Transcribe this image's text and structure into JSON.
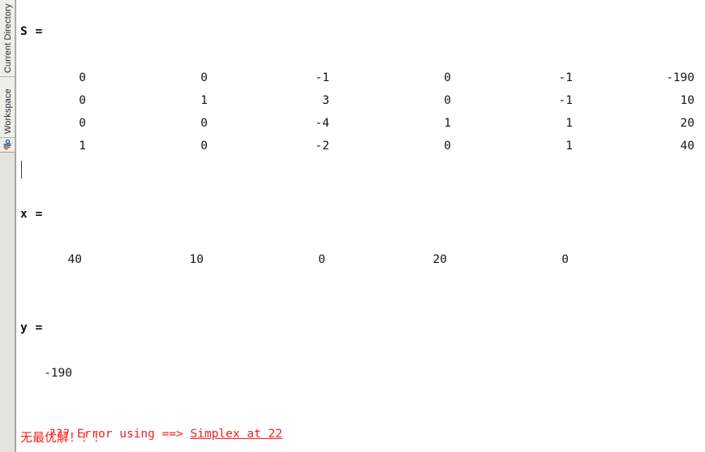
{
  "sidebar": {
    "tabs": [
      {
        "id": "current-directory",
        "label": "Current Directory"
      },
      {
        "id": "workspace",
        "label": "Workspace"
      }
    ],
    "logo_icon": "matlab-membrane-icon"
  },
  "command_window": {
    "blocks": [
      {
        "name": "S",
        "label": "S =",
        "kind": "matrix",
        "rows": [
          [
            "0",
            "0",
            "-1",
            "0",
            "-1",
            "-190"
          ],
          [
            "0",
            "1",
            "3",
            "0",
            "-1",
            "10"
          ],
          [
            "0",
            "0",
            "-4",
            "1",
            "1",
            "20"
          ],
          [
            "1",
            "0",
            "-2",
            "0",
            "1",
            "40"
          ]
        ]
      },
      {
        "name": "x",
        "label": "x =",
        "kind": "row-vector",
        "rows": [
          [
            "40",
            "10",
            "0",
            "20",
            "0"
          ]
        ]
      },
      {
        "name": "y",
        "label": "y =",
        "kind": "scalar",
        "rows": [
          [
            "-190"
          ]
        ]
      }
    ],
    "error": {
      "prefix": "??? Error using ==> ",
      "link": "Simplex at 22",
      "message": "无最优解！！！",
      "color": "#ef2020"
    },
    "caret_visible": true
  }
}
